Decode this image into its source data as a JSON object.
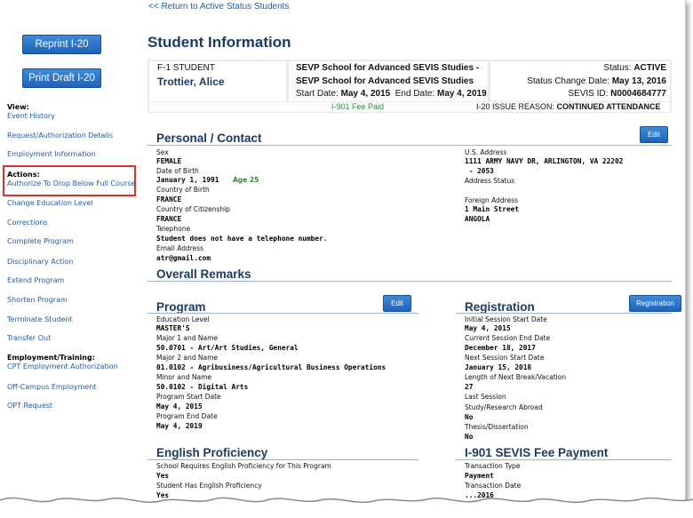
{
  "top_link": "<< Return to Active Status Students",
  "buttons": {
    "reprint": "Reprint I-20",
    "print_draft": "Print Draft I-20",
    "edit": "Edit",
    "edit2": "Edit",
    "registration": "Registration"
  },
  "sidebar": {
    "view_head": "View:",
    "event_history": "Event History",
    "request_auth": "Request/Authorization Details",
    "employment_info": "Employment Information",
    "actions_head": "Actions:",
    "authorize_drop": "Authorize To Drop Below Full Course",
    "change_edu": "Change Education Level",
    "corrections": "Corrections",
    "complete_program": "Complete Program",
    "disciplinary": "Disciplinary Action",
    "extend": "Extend Program",
    "shorten": "Shorten Program",
    "terminate": "Terminate Student",
    "transfer": "Transfer Out",
    "emp_head": "Employment/Training:",
    "cpt": "CPT Employment Authorization",
    "off_campus": "Off-Campus Employment",
    "opt": "OPT Request"
  },
  "header": {
    "title": "Student Information",
    "student_type": "F-1 STUDENT",
    "student_name": "Trottier, Alice",
    "school_line1": "SEVP School for Advanced SEVIS Studies -",
    "school_line2": "SEVP School for Advanced SEVIS Studies",
    "start_label": "Start Date:",
    "start_value": "May 4, 2015",
    "end_label": "End Date:",
    "end_value": "May 4, 2019",
    "status_label": "Status:",
    "status_value": "ACTIVE",
    "status_change_label": "Status Change Date:",
    "status_change_value": "May 13, 2016",
    "sevis_label": "SEVIS ID:",
    "sevis_value": "N0004684777",
    "fee_paid": "I-901 Fee Paid",
    "issue_label": "I-20 ISSUE REASON:",
    "issue_value": "CONTINUED ATTENDANCE"
  },
  "personal": {
    "title": "Personal / Contact",
    "sex_label": "Sex",
    "sex": "FEMALE",
    "dob_label": "Date of Birth",
    "dob": "January 1, 1991",
    "age": "Age 25",
    "cob_label": "Country of Birth",
    "cob": "FRANCE",
    "coc_label": "Country of Citizenship",
    "coc": "FRANCE",
    "tel_label": "Telephone",
    "tel": "Student does not have a telephone number.",
    "email_label": "Email Address",
    "email": "atr@gmail.com",
    "us_addr_label": "U.S. Address",
    "us_addr1": "1111 ARMY NAVY DR,  ARLINGTON,  VA 22202",
    "us_addr2": " - 2053",
    "addr_status_label": "Address Status",
    "foreign_label": "Foreign Address",
    "foreign1": "1 Main Street",
    "foreign2": "ANGOLA"
  },
  "remarks": {
    "title": "Overall Remarks"
  },
  "program": {
    "title": "Program",
    "edu_label": "Education Level",
    "edu": "MASTER'S",
    "major1_label": "Major 1 and Name",
    "major1": "50.0701 - Art/Art Studies, General",
    "major2_label": "Major 2 and Name",
    "major2": "01.0102 - Agribusiness/Agricultural Business Operations",
    "minor_label": "Minor and Name",
    "minor": "50.0102 - Digital Arts",
    "start_label": "Program Start Date",
    "start": "May 4, 2015",
    "end_label": "Program End Date",
    "end": "May 4, 2019"
  },
  "registration": {
    "title": "Registration",
    "init_label": "Initial Session Start Date",
    "init": "May 4, 2015",
    "cur_end_label": "Current Session End Date",
    "cur_end": "December 18, 2017",
    "next_label": "Next Session Start Date",
    "next": "January 15, 2018",
    "break_label": "Length of Next Break/Vacation",
    "break": "27",
    "last_label": "Last Session",
    "abroad_label": "Study/Research Abroad",
    "abroad": "No",
    "thesis_label": "Thesis/Dissertation",
    "thesis": "No"
  },
  "english": {
    "title": "English Proficiency",
    "req_label": "School Requires English Proficiency for This Program",
    "req": "Yes",
    "has_label": "Student Has English Proficiency",
    "has": "Yes"
  },
  "fee": {
    "title": "I-901 SEVIS Fee Payment",
    "type_label": "Transaction Type",
    "type": "Payment",
    "date_label": "Transaction Date",
    "date": "...2016"
  },
  "colors": {
    "accent": "#1f63b8",
    "heading": "#1a3b66",
    "link": "#1f5da8",
    "highlight": "#d9342b",
    "fee_green": "#2f8a2f"
  }
}
